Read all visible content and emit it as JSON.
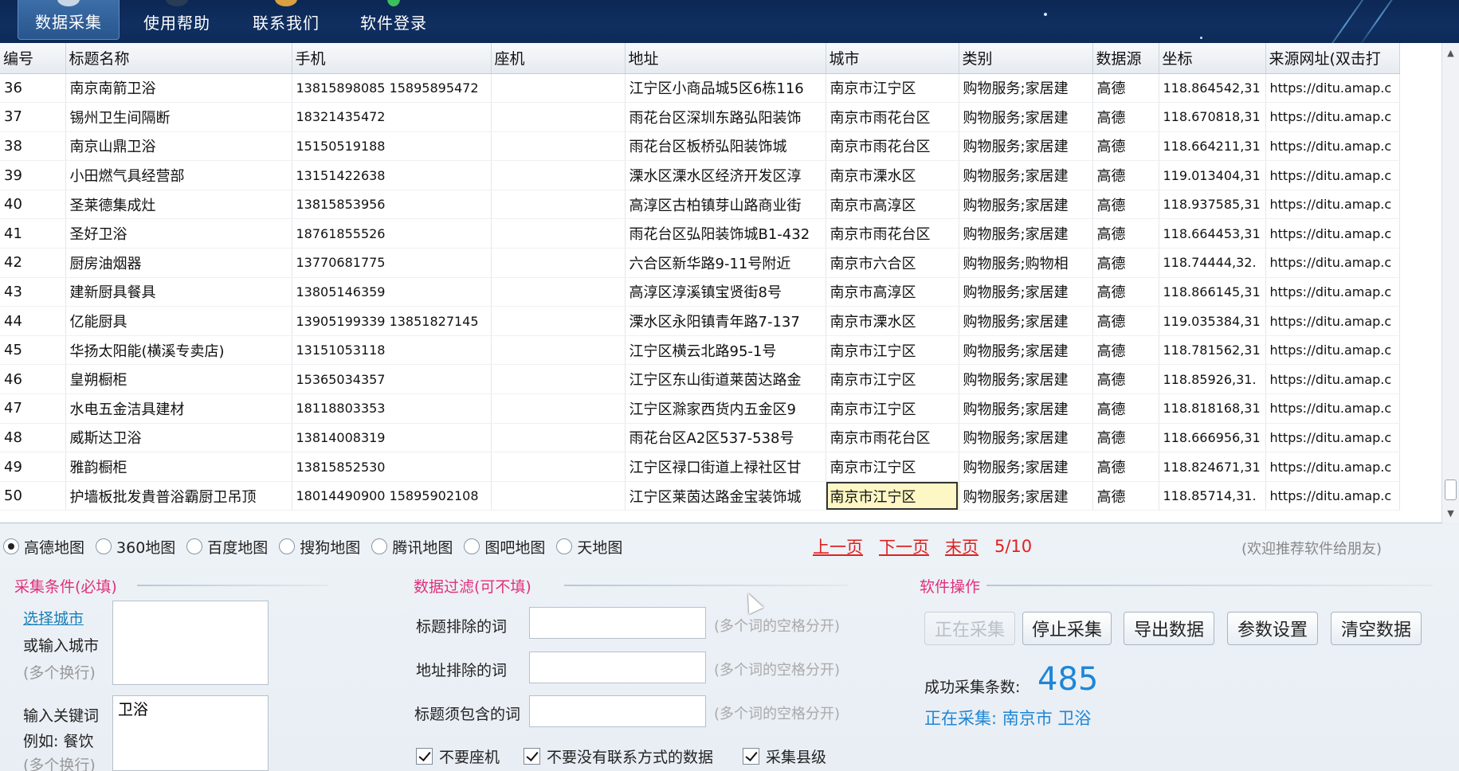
{
  "toolbar": {
    "items": [
      {
        "label": "数据采集",
        "active": true,
        "icon": "globe-icon"
      },
      {
        "label": "使用帮助",
        "active": false,
        "icon": "help-icon"
      },
      {
        "label": "联系我们",
        "active": false,
        "icon": "contact-icon"
      },
      {
        "label": "软件登录",
        "active": false,
        "icon": "login-icon"
      }
    ]
  },
  "table": {
    "columns": [
      "编号",
      "标题名称",
      "手机",
      "座机",
      "地址",
      "城市",
      "类别",
      "数据源",
      "坐标",
      "来源网址(双击打"
    ],
    "rows": [
      [
        "36",
        "南京南箭卫浴",
        "13815898085 15895895472",
        "",
        "江宁区小商品城5区6栋116",
        "南京市江宁区",
        "购物服务;家居建",
        "高德",
        "118.864542,31",
        "https://ditu.amap.c"
      ],
      [
        "37",
        "锡州卫生间隔断",
        "18321435472",
        "",
        "雨花台区深圳东路弘阳装饰",
        "南京市雨花台区",
        "购物服务;家居建",
        "高德",
        "118.670818,31",
        "https://ditu.amap.c"
      ],
      [
        "38",
        "南京山鼎卫浴",
        "15150519188",
        "",
        "雨花台区板桥弘阳装饰城",
        "南京市雨花台区",
        "购物服务;家居建",
        "高德",
        "118.664211,31",
        "https://ditu.amap.c"
      ],
      [
        "39",
        "小田燃气具经营部",
        "13151422638",
        "",
        "溧水区溧水区经济开发区淳",
        "南京市溧水区",
        "购物服务;家居建",
        "高德",
        "119.013404,31",
        "https://ditu.amap.c"
      ],
      [
        "40",
        "圣莱德集成灶",
        "13815853956",
        "",
        "高淳区古柏镇芽山路商业街",
        "南京市高淳区",
        "购物服务;家居建",
        "高德",
        "118.937585,31",
        "https://ditu.amap.c"
      ],
      [
        "41",
        "圣好卫浴",
        "18761855526",
        "",
        "雨花台区弘阳装饰城B1-432",
        "南京市雨花台区",
        "购物服务;家居建",
        "高德",
        "118.664453,31",
        "https://ditu.amap.c"
      ],
      [
        "42",
        "厨房油烟器",
        "13770681775",
        "",
        "六合区新华路9-11号附近",
        "南京市六合区",
        "购物服务;购物相",
        "高德",
        "118.74444,32.",
        "https://ditu.amap.c"
      ],
      [
        "43",
        "建新厨具餐具",
        "13805146359",
        "",
        "高淳区淳溪镇宝贤街8号",
        "南京市高淳区",
        "购物服务;家居建",
        "高德",
        "118.866145,31",
        "https://ditu.amap.c"
      ],
      [
        "44",
        "亿能厨具",
        "13905199339 13851827145",
        "",
        "溧水区永阳镇青年路7-137",
        "南京市溧水区",
        "购物服务;家居建",
        "高德",
        "119.035384,31",
        "https://ditu.amap.c"
      ],
      [
        "45",
        "华扬太阳能(横溪专卖店)",
        "13151053118",
        "",
        "江宁区横云北路95-1号",
        "南京市江宁区",
        "购物服务;家居建",
        "高德",
        "118.781562,31",
        "https://ditu.amap.c"
      ],
      [
        "46",
        "皇朔橱柜",
        "15365034357",
        "",
        "江宁区东山街道莱茵达路金",
        "南京市江宁区",
        "购物服务;家居建",
        "高德",
        "118.85926,31.",
        "https://ditu.amap.c"
      ],
      [
        "47",
        "水电五金洁具建材",
        "18118803353",
        "",
        "江宁区滁家西货内五金区9",
        "南京市江宁区",
        "购物服务;家居建",
        "高德",
        "118.818168,31",
        "https://ditu.amap.c"
      ],
      [
        "48",
        "威斯达卫浴",
        "13814008319",
        "",
        "雨花台区A2区537-538号",
        "南京市雨花台区",
        "购物服务;家居建",
        "高德",
        "118.666956,31",
        "https://ditu.amap.c"
      ],
      [
        "49",
        "雅韵橱柜",
        "13815852530",
        "",
        "江宁区禄口街道上禄社区甘",
        "南京市江宁区",
        "购物服务;家居建",
        "高德",
        "118.824671,31",
        "https://ditu.amap.c"
      ],
      [
        "50",
        "护墙板批发貴普浴霸厨卫吊顶",
        "18014490900 15895902108",
        "",
        "江宁区莱茵达路金宝装饰城",
        "南京市江宁区",
        "购物服务;家居建",
        "高德",
        "118.85714,31.",
        "https://ditu.amap.c"
      ]
    ],
    "selected_row": 14,
    "selected_col": 5
  },
  "map_sources": {
    "options": [
      "高德地图",
      "360地图",
      "百度地图",
      "搜狗地图",
      "腾讯地图",
      "图吧地图",
      "天地图"
    ],
    "selected": "高德地图"
  },
  "pager": {
    "prev": "上一页",
    "next": "下一页",
    "last": "末页",
    "page_info": "5/10"
  },
  "recommend_hint": "(欢迎推荐软件给朋友)",
  "collect": {
    "title": "采集条件(必填)",
    "select_city": "选择城市",
    "or_input_city": "或输入城市",
    "multi_line_hint": "(多个换行)",
    "city_value": "",
    "keyword_label_1": "输入关键词",
    "keyword_label_2": "例如: 餐饮",
    "keyword_value": "卫浴"
  },
  "filter": {
    "title": "数据过滤(可不填)",
    "title_exclude_label": "标题排除的词",
    "address_exclude_label": "地址排除的词",
    "title_include_label": "标题须包含的词",
    "space_hint": "(多个词的空格分开)",
    "title_exclude_value": "",
    "address_exclude_value": "",
    "title_include_value": "",
    "checks": [
      {
        "label": "不要座机",
        "checked": true
      },
      {
        "label": "不要没有联系方式的数据",
        "checked": true
      },
      {
        "label": "采集县级",
        "checked": true
      }
    ]
  },
  "ops": {
    "title": "软件操作",
    "buttons": [
      {
        "label": "正在采集",
        "disabled": true
      },
      {
        "label": "停止采集",
        "disabled": false
      },
      {
        "label": "导出数据",
        "disabled": false
      },
      {
        "label": "参数设置",
        "disabled": false
      },
      {
        "label": "清空数据",
        "disabled": false
      }
    ],
    "success_label": "成功采集条数:",
    "success_count": "485",
    "status_text": "正在采集: 南京市 卫浴"
  },
  "colors": {
    "title_pink": "#e0307a",
    "accent_blue": "#1e86d6",
    "link_red": "#e02020"
  }
}
